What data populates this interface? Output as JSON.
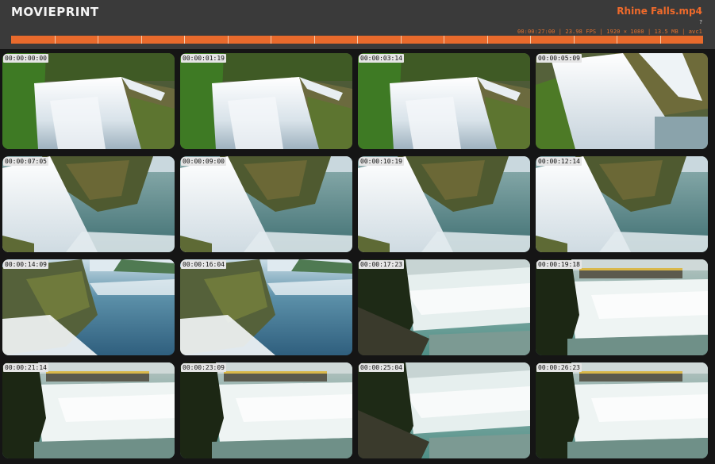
{
  "app": {
    "name": "MOVIEPRINT"
  },
  "file": {
    "title": "Rhine Falls.mp4",
    "help": "?",
    "meta": "00:00:27:00 | 23.98 FPS | 1920 × 1080 | 13.5 MB | avc1"
  },
  "colors": {
    "accent": "#e86a2c",
    "header_bg": "#3a3a3a",
    "page_bg": "#151515"
  },
  "thumbnails": [
    {
      "timecode": "00:00:00:00",
      "scene": "cascade-left"
    },
    {
      "timecode": "00:00:01:19",
      "scene": "cascade-left"
    },
    {
      "timecode": "00:00:03:14",
      "scene": "cascade-left"
    },
    {
      "timecode": "00:00:05:09",
      "scene": "cascade-right"
    },
    {
      "timecode": "00:00:07:05",
      "scene": "falls-pool"
    },
    {
      "timecode": "00:00:09:00",
      "scene": "falls-pool"
    },
    {
      "timecode": "00:00:10:19",
      "scene": "falls-pool"
    },
    {
      "timecode": "00:00:12:14",
      "scene": "falls-pool"
    },
    {
      "timecode": "00:00:14:09",
      "scene": "river-blue"
    },
    {
      "timecode": "00:00:16:04",
      "scene": "river-blue"
    },
    {
      "timecode": "00:00:17:23",
      "scene": "rapids-tree"
    },
    {
      "timecode": "00:00:19:18",
      "scene": "rapids-boat"
    },
    {
      "timecode": "00:00:21:14",
      "scene": "rapids-boat"
    },
    {
      "timecode": "00:00:23:09",
      "scene": "rapids-boat"
    },
    {
      "timecode": "00:00:25:04",
      "scene": "rapids-tree"
    },
    {
      "timecode": "00:00:26:23",
      "scene": "rapids-boat"
    }
  ]
}
